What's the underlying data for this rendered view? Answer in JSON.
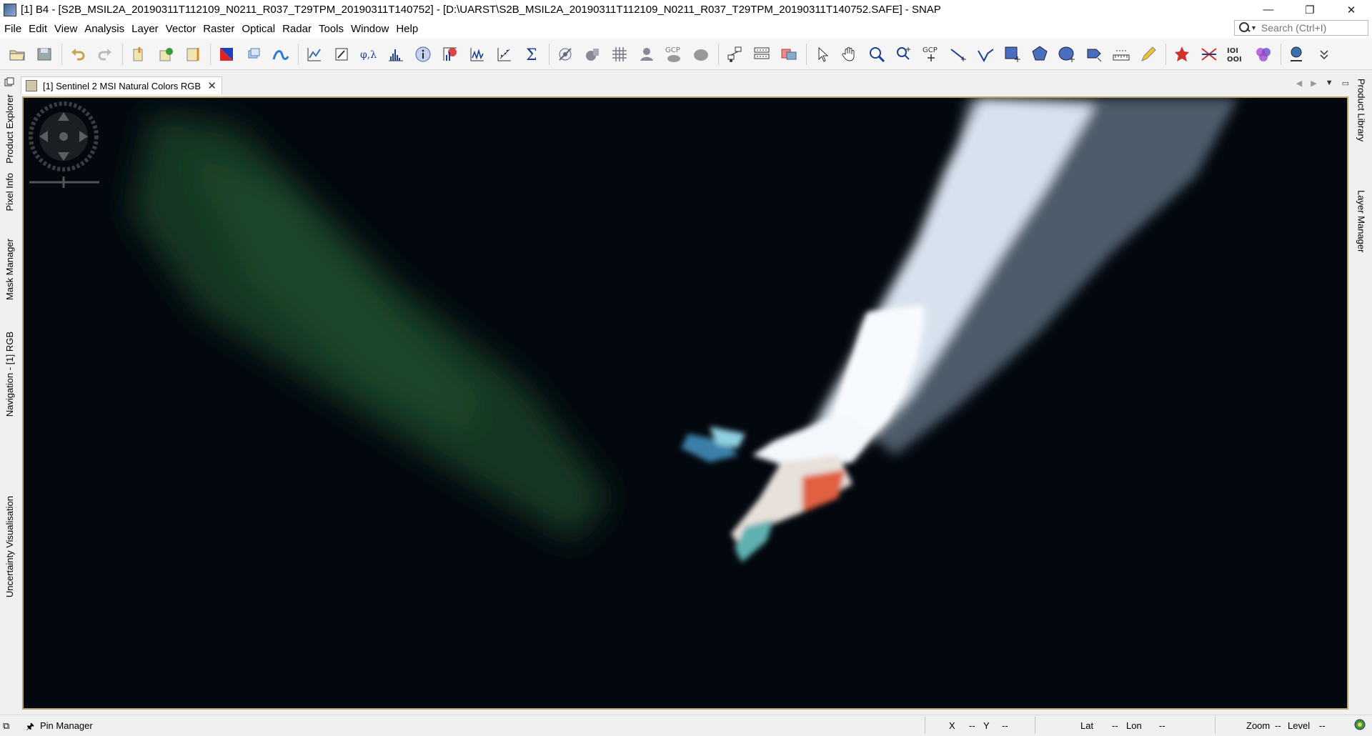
{
  "window": {
    "title": "[1] B4 - [S2B_MSIL2A_20190311T112109_N0211_R037_T29TPM_20190311T140752] - [D:\\UARST\\S2B_MSIL2A_20190311T112109_N0211_R037_T29TPM_20190311T140752.SAFE] - SNAP",
    "minimize": "—",
    "restore": "❐",
    "close": "✕"
  },
  "menu": [
    "File",
    "Edit",
    "View",
    "Analysis",
    "Layer",
    "Vector",
    "Raster",
    "Optical",
    "Radar",
    "Tools",
    "Window",
    "Help"
  ],
  "search": {
    "placeholder": "Search (Ctrl+I)"
  },
  "toolbar": {
    "phi_lambda_label": "φ,λ",
    "gcp_label": "GCP",
    "ioi_label": "IOI"
  },
  "left_panel_tabs": [
    "Product Explorer",
    "Pixel Info",
    "Mask Manager",
    "Navigation - [1] RGB",
    "Uncertainty Visualisation"
  ],
  "right_panel_tabs": [
    "Product Library",
    "Layer Manager"
  ],
  "document_tab": {
    "label": "[1] Sentinel 2 MSI Natural Colors RGB",
    "close": "✕"
  },
  "bottom_panel": {
    "label": "Pin Manager"
  },
  "status": {
    "x": "X",
    "x_val": "--",
    "y": "Y",
    "y_val": "--",
    "lat": "Lat",
    "lat_val": "--",
    "lon": "Lon",
    "lon_val": "--",
    "zoom": "Zoom",
    "zoom_val": "--",
    "level": "Level",
    "level_val": "--"
  },
  "colors": {
    "image_border": "#b8a46a",
    "background": "#020812"
  }
}
